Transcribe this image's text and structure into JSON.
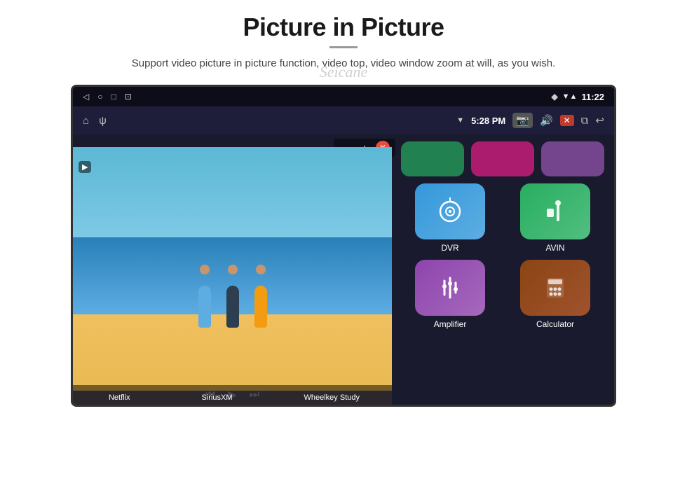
{
  "header": {
    "title": "Picture in Picture",
    "watermark": "Seicane",
    "subtitle": "Support video picture in picture function, video top, video window zoom at will, as you wish."
  },
  "device": {
    "statusBar": {
      "navIcons": [
        "◁",
        "○",
        "□",
        "⊡"
      ],
      "rightIcons": [
        "▼",
        "▲"
      ],
      "time": "11:22"
    },
    "toolbar": {
      "homeIcon": "⌂",
      "usbIcon": "ψ",
      "time": "5:28 PM",
      "cameraIcon": "📷",
      "volumeIcon": "🔊",
      "closeIcon": "✕",
      "windowIcon": "⧉",
      "backIcon": "↩"
    }
  },
  "apps": {
    "topRow": [
      {
        "label": "Netflix",
        "color": "#27ae60"
      },
      {
        "label": "SiriusXM",
        "color": "#e91e8c"
      },
      {
        "label": "Wheelkey Study",
        "color": "#9b59b6"
      }
    ],
    "mainGrid": [
      {
        "id": "dvr",
        "label": "DVR",
        "icon": "📡",
        "colorClass": "app-icon-dvr"
      },
      {
        "id": "avin",
        "label": "AVIN",
        "icon": "🔌",
        "colorClass": "app-icon-avin"
      },
      {
        "id": "amplifier",
        "label": "Amplifier",
        "icon": "🎚",
        "colorClass": "app-icon-amplifier"
      },
      {
        "id": "calculator",
        "label": "Calculator",
        "icon": "🧮",
        "colorClass": "app-icon-calculator"
      }
    ]
  },
  "pip": {
    "minusBtn": "−",
    "plusBtn": "+",
    "closeBtn": "✕",
    "recordLabel": "▶"
  },
  "bottomLabels": [
    "Netflix",
    "SiriusXM",
    "Wheelkey Study"
  ]
}
